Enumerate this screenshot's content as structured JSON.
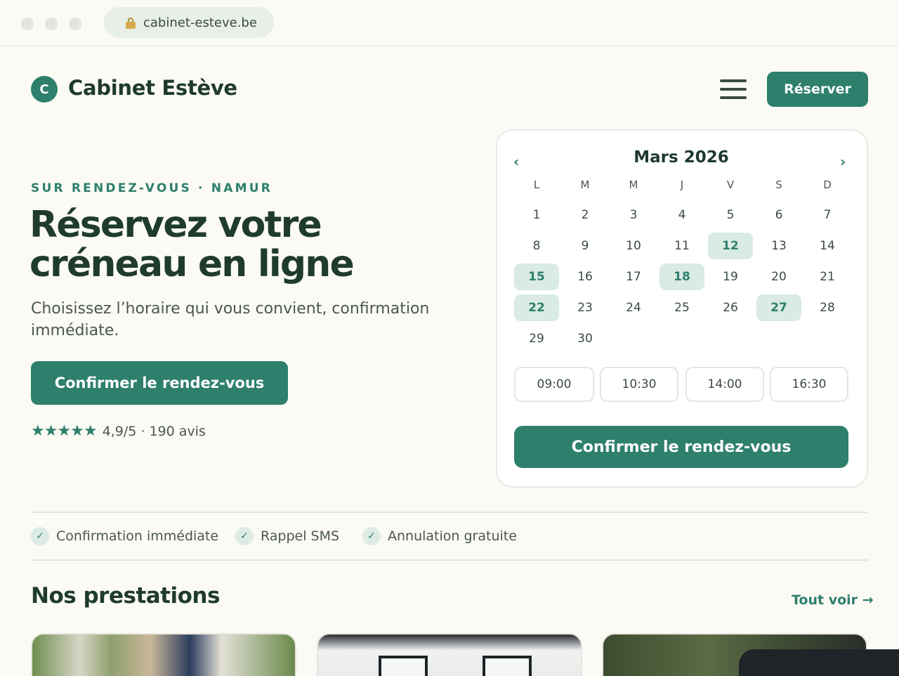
{
  "browser": {
    "url": "cabinet-esteve.be"
  },
  "header": {
    "logo_letter": "C",
    "brand": "Cabinet Estève",
    "reserve_label": "Réserver"
  },
  "hero": {
    "eyebrow": "SUR RENDEZ-VOUS · NAMUR",
    "title": "Réservez votre créneau en ligne",
    "subtitle": "Choisissez l’horaire qui vous convient, confirmation immédiate.",
    "cta_label": "Confirmer le rendez-vous",
    "stars": "★★★★★",
    "rating_text": "4,9/5 · 190 avis"
  },
  "calendar": {
    "month": "Mars 2026",
    "prev_icon": "‹",
    "next_icon": "›",
    "weekdays": [
      "L",
      "M",
      "M",
      "J",
      "V",
      "S",
      "D"
    ],
    "weeks": [
      [
        "1",
        "2",
        "3",
        "4",
        "5",
        "6",
        "7"
      ],
      [
        "8",
        "9",
        "10",
        "11",
        "12",
        "13",
        "14"
      ],
      [
        "15",
        "16",
        "17",
        "18",
        "19",
        "20",
        "21"
      ],
      [
        "22",
        "23",
        "24",
        "25",
        "26",
        "27",
        "28"
      ],
      [
        "29",
        "30",
        "",
        "",
        "",
        "",
        ""
      ]
    ],
    "available_days": [
      "12",
      "15",
      "18",
      "22",
      "27"
    ],
    "time_slots": [
      "09:00",
      "10:30",
      "14:00",
      "16:30"
    ],
    "confirm_label": "Confirmer le rendez-vous"
  },
  "features": [
    {
      "icon": "check-icon",
      "label": "Confirmation immédiate"
    },
    {
      "icon": "check-icon",
      "label": "Rappel SMS"
    },
    {
      "icon": "check-icon",
      "label": "Annulation gratuite"
    }
  ],
  "services": {
    "title": "Nos prestations",
    "see_all": "Tout voir →"
  },
  "colors": {
    "accent": "#2e7f6c",
    "accent_soft": "#d9ebe3",
    "text_dark": "#1f3b2e",
    "background": "#fbfaf4"
  }
}
